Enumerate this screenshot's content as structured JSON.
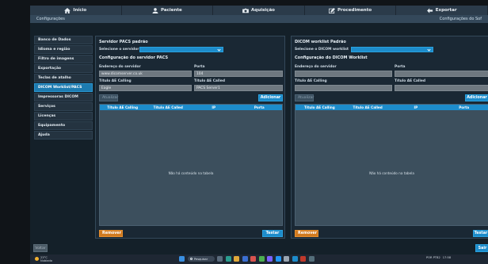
{
  "topnav": {
    "items": [
      {
        "label": "Início",
        "icon": "home-icon"
      },
      {
        "label": "Paciente",
        "icon": "person-icon"
      },
      {
        "label": "Aquisição",
        "icon": "camera-icon"
      },
      {
        "label": "Procedimento",
        "icon": "edit-icon"
      },
      {
        "label": "Exportar",
        "icon": "export-icon"
      }
    ]
  },
  "subhead": {
    "title": "Configurações",
    "breadcrumb": "Configurações do Sof"
  },
  "sidebar": {
    "items": [
      {
        "label": "Banco de Dados",
        "active": false
      },
      {
        "label": "Idioma e região",
        "active": false
      },
      {
        "label": "Filtro de imagens",
        "active": false
      },
      {
        "label": "Exportação",
        "active": false
      },
      {
        "label": "Teclas de atalho",
        "active": false
      },
      {
        "label": "DICOM Worklist/PACS",
        "active": true
      },
      {
        "label": "Impressoras DICOM",
        "active": false
      },
      {
        "label": "Serviços",
        "active": false
      },
      {
        "label": "Licenças",
        "active": false
      },
      {
        "label": "Equipamento",
        "active": false
      },
      {
        "label": "Ajuda",
        "active": false
      }
    ]
  },
  "pacs": {
    "title": "Servidor PACS padrão",
    "select_label": "Selecione o servidor",
    "select_value": "",
    "config_title": "Configuração do servidor PACS",
    "address_label": "Endereço do servidor",
    "address_value": "www.dicomserver.co.uk",
    "port_label": "Porta",
    "port_value": "104",
    "calling_label": "Título AE Calling",
    "calling_value": "Eagle",
    "called_label": "Título AE Called",
    "called_value": "PACS Server1",
    "update_btn": "Atualizar",
    "add_btn": "Adicionar",
    "columns": [
      "Título AE Calling",
      "Título AE Called",
      "IP",
      "Porta"
    ],
    "empty_msg": "Não há conteúdo na tabela",
    "remove_btn": "Remover",
    "test_btn": "Testar"
  },
  "worklist": {
    "title": "DICOM worklist Padrão",
    "select_label": "Selecione o DICOM worklist",
    "select_value": "",
    "config_title": "Configuração do DICOM Worklist",
    "address_label": "Endereço do servidor",
    "address_value": "",
    "port_label": "Porta",
    "port_value": "",
    "calling_label": "Título AE Calling",
    "calling_value": "",
    "called_label": "Título AE Called",
    "called_value": "",
    "update_btn": "Atualizar",
    "add_btn": "Adicionar",
    "columns": [
      "Título AE Calling",
      "Título AE Called",
      "IP",
      "Porta"
    ],
    "empty_msg": "Não há conteúdo na tabela",
    "remove_btn": "Remover",
    "test_btn": "Testar"
  },
  "footer": {
    "back_btn": "Voltar",
    "exit_btn": "Sair"
  },
  "taskbar": {
    "weather_temp": "23°C",
    "weather_desc": "Nublado",
    "search_placeholder": "Pesquisar",
    "tray_lang": "POR PTB2",
    "tray_time": "17:58",
    "tray_date": "11/07/2023"
  },
  "colors": {
    "accent": "#1d8ccb",
    "warn": "#d17a1f",
    "bg": "#142029",
    "nav": "#2b3b4a"
  }
}
